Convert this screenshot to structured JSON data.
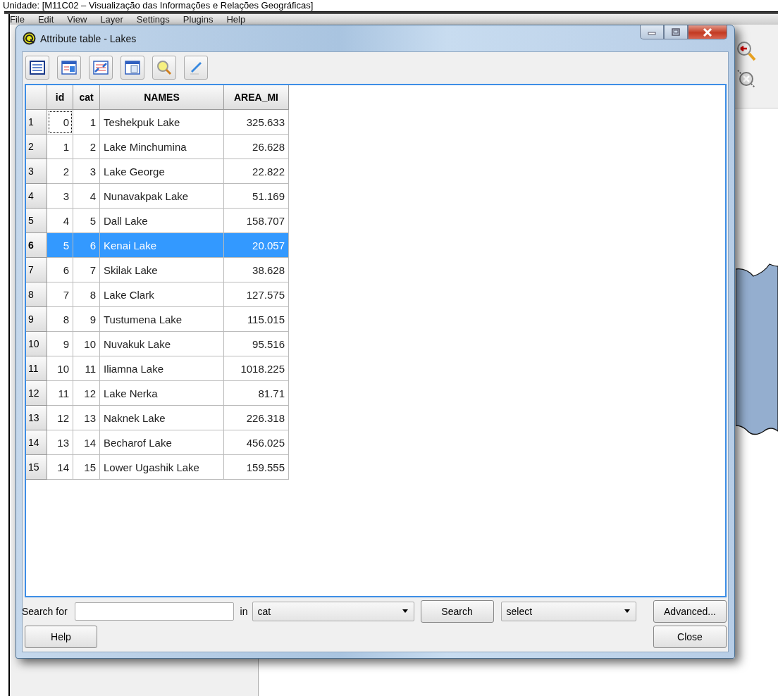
{
  "page_heading": "Unidade: [M11C02 – Visualização das Informações e Relações Geográficas]",
  "menu": [
    "File",
    "Edit",
    "View",
    "Layer",
    "Settings",
    "Plugins",
    "Help"
  ],
  "dialog": {
    "title": "Attribute table - Lakes",
    "table": {
      "columns": [
        "id",
        "cat",
        "NAMES",
        "AREA_MI"
      ],
      "rows": [
        {
          "header": "1",
          "cells": [
            "0",
            "1",
            "Teshekpuk Lake",
            "325.633"
          ],
          "selected": false,
          "focused": true
        },
        {
          "header": "2",
          "cells": [
            "1",
            "2",
            "Lake Minchumina",
            "26.628"
          ],
          "selected": false,
          "focused": false
        },
        {
          "header": "3",
          "cells": [
            "2",
            "3",
            "Lake George",
            "22.822"
          ],
          "selected": false,
          "focused": false
        },
        {
          "header": "4",
          "cells": [
            "3",
            "4",
            "Nunavakpak Lake",
            "51.169"
          ],
          "selected": false,
          "focused": false
        },
        {
          "header": "5",
          "cells": [
            "4",
            "5",
            "Dall Lake",
            "158.707"
          ],
          "selected": false,
          "focused": false
        },
        {
          "header": "6",
          "cells": [
            "5",
            "6",
            "Kenai Lake",
            "20.057"
          ],
          "selected": true,
          "focused": false
        },
        {
          "header": "7",
          "cells": [
            "6",
            "7",
            "Skilak Lake",
            "38.628"
          ],
          "selected": false,
          "focused": false
        },
        {
          "header": "8",
          "cells": [
            "7",
            "8",
            "Lake Clark",
            "127.575"
          ],
          "selected": false,
          "focused": false
        },
        {
          "header": "9",
          "cells": [
            "8",
            "9",
            "Tustumena Lake",
            "115.015"
          ],
          "selected": false,
          "focused": false
        },
        {
          "header": "10",
          "cells": [
            "9",
            "10",
            "Nuvakuk Lake",
            "95.516"
          ],
          "selected": false,
          "focused": false
        },
        {
          "header": "11",
          "cells": [
            "10",
            "11",
            "Iliamna Lake",
            "1018.225"
          ],
          "selected": false,
          "focused": false
        },
        {
          "header": "12",
          "cells": [
            "11",
            "12",
            "Lake Nerka",
            "81.71"
          ],
          "selected": false,
          "focused": false
        },
        {
          "header": "13",
          "cells": [
            "12",
            "13",
            "Naknek Lake",
            "226.318"
          ],
          "selected": false,
          "focused": false
        },
        {
          "header": "14",
          "cells": [
            "13",
            "14",
            "Becharof Lake",
            "456.025"
          ],
          "selected": false,
          "focused": false
        },
        {
          "header": "15",
          "cells": [
            "14",
            "15",
            "Lower Ugashik Lake",
            "159.555"
          ],
          "selected": false,
          "focused": false
        }
      ]
    },
    "search": {
      "label": "Search for",
      "in_label": "in",
      "field": "cat",
      "button": "Search",
      "mode": "select",
      "advanced": "Advanced..."
    },
    "help_button": "Help",
    "close_button": "Close"
  }
}
